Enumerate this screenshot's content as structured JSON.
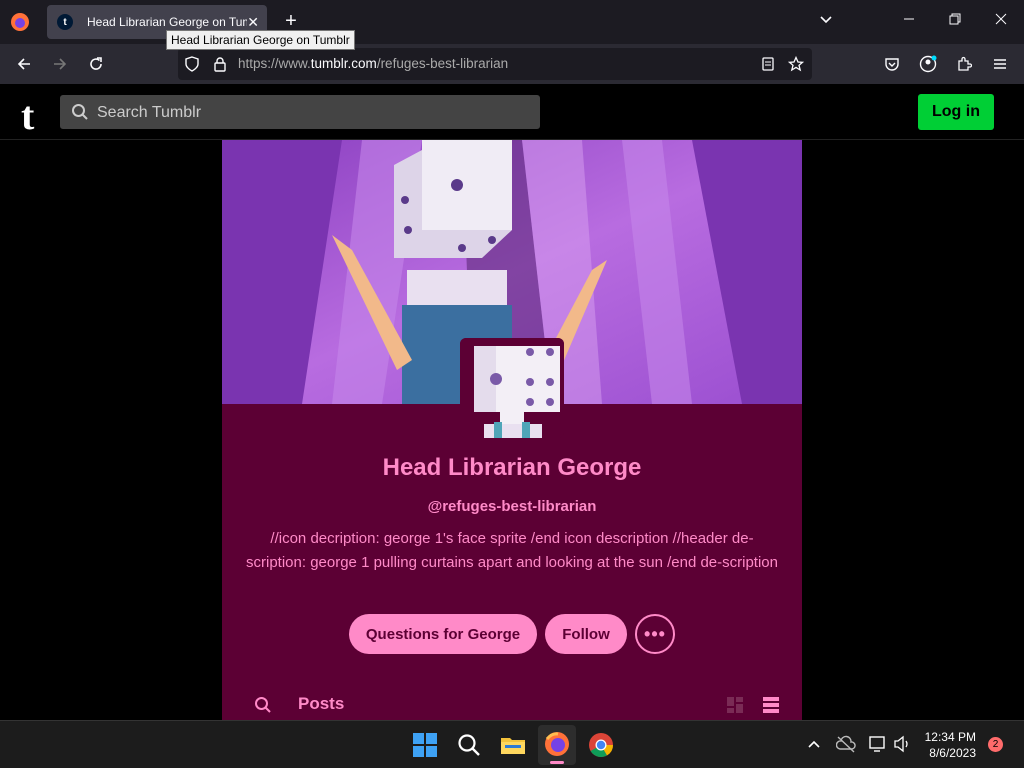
{
  "browser": {
    "tab_title": "Head Librarian George on Tumblr",
    "tab_close": "✕",
    "new_tab": "+",
    "tooltip": "Head Librarian George on Tumblr",
    "url_prefix": "https://www.",
    "url_domain": "tumblr.com",
    "url_path": "/refuges-best-librarian"
  },
  "tumblr": {
    "logo": "t",
    "search_placeholder": "Search Tumblr",
    "login_label": "Log in"
  },
  "blog": {
    "title": "Head Librarian George",
    "handle": "@refuges-best-librarian",
    "description": "//icon decription: george 1's face sprite /end icon description //header de-scription: george 1 pulling curtains apart and looking at the sun /end de-scription",
    "ask_button": "Questions for George",
    "follow_button": "Follow",
    "more_button": "•••",
    "posts_tab": "Posts"
  },
  "taskbar": {
    "time": "12:34 PM",
    "date": "8/6/2023",
    "notification_count": "2"
  },
  "colors": {
    "blog_bg": "#5c0034",
    "accent": "#ff8ac8",
    "login_green": "#00cf35"
  }
}
